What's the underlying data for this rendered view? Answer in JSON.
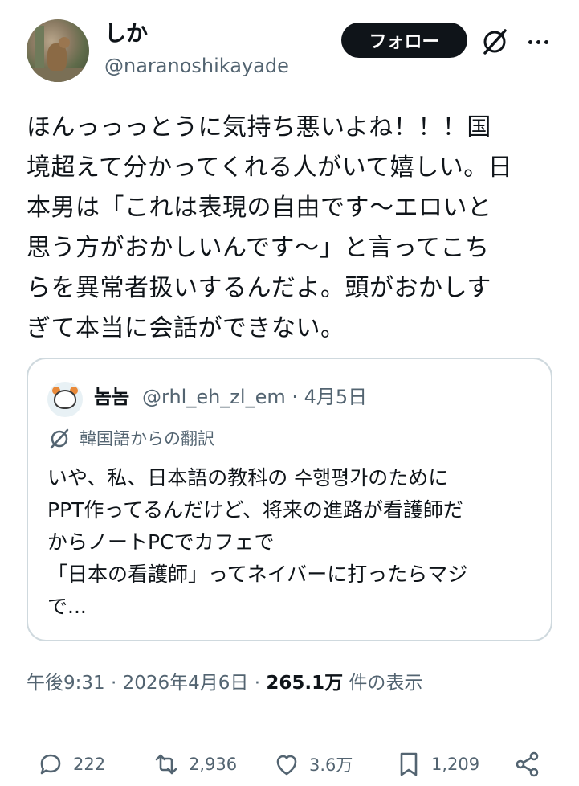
{
  "author": {
    "display_name": "しか",
    "handle": "@naranoshikayade",
    "follow_label": "フォロー"
  },
  "tweet": {
    "text": "ほんっっっとうに気持ち悪いよね！！！国\n境超えて分かってくれる人がいて嬉しい。日\n本男は「これは表現の自由です〜エロいと\n思う方がおかしいんです〜」と言ってこち\nらを異常者扱いするんだよ。頭がおかしす\nぎて本当に会話ができない。"
  },
  "quote": {
    "display_name": "놈놈",
    "meta": "@rhl_eh_zl_em · 4月5日",
    "translation_label": "韓国語からの翻訳",
    "text": "いや、私、日本語の教科の 수행평가のために\nPPT作ってるんだけど、将来の進路が看護師だ\nからノートPCでカフェで\n「日本の看護師」ってネイバーに打ったらマジ\nで..."
  },
  "meta": {
    "time_date": "午後9:31 · 2026年4月6日 · ",
    "views": "265.1万",
    "views_suffix": " 件の表示"
  },
  "actions": {
    "replies": "222",
    "reposts": "2,936",
    "likes": "3.6万",
    "bookmarks": "1,209"
  },
  "icons": [
    "grok-icon",
    "more-icon",
    "translate-icon",
    "reply-icon",
    "repost-icon",
    "like-icon",
    "bookmark-icon",
    "share-icon"
  ]
}
